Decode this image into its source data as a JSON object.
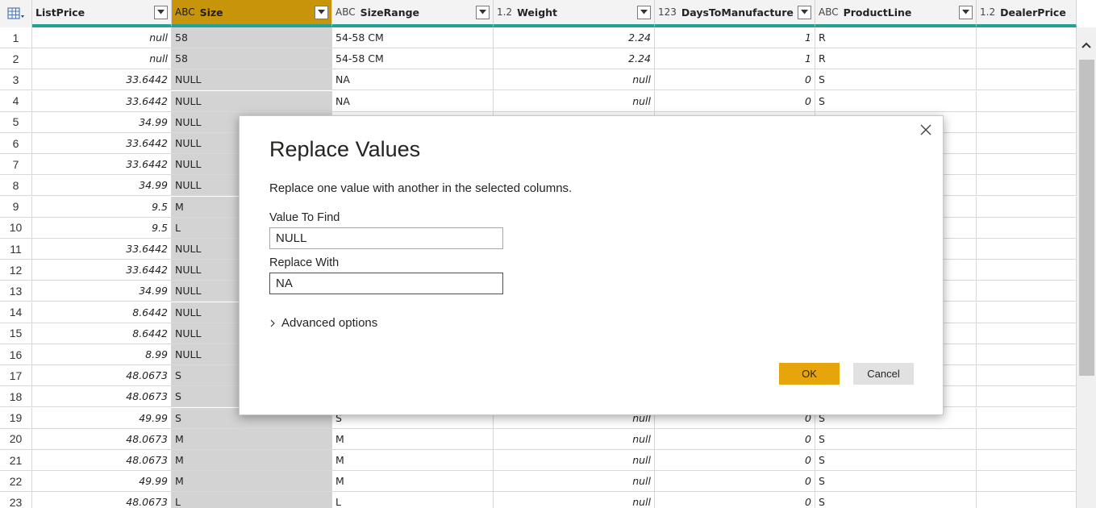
{
  "columns": [
    {
      "name": "ListPrice",
      "type_icon": "",
      "selected": false
    },
    {
      "name": "Size",
      "type_icon": "ABC",
      "selected": true
    },
    {
      "name": "SizeRange",
      "type_icon": "ABC",
      "selected": false
    },
    {
      "name": "Weight",
      "type_icon": "1.2",
      "selected": false
    },
    {
      "name": "DaysToManufacture",
      "type_icon": "123",
      "selected": false
    },
    {
      "name": "ProductLine",
      "type_icon": "ABC",
      "selected": false
    },
    {
      "name": "DealerPrice",
      "type_icon": "1.2",
      "selected": false
    }
  ],
  "rows": [
    {
      "n": "1",
      "ListPrice": "null",
      "Size": "58",
      "SizeRange": "54-58 CM",
      "Weight": "2.24",
      "Days": "1",
      "ProductLine": "R"
    },
    {
      "n": "2",
      "ListPrice": "null",
      "Size": "58",
      "SizeRange": "54-58 CM",
      "Weight": "2.24",
      "Days": "1",
      "ProductLine": "R"
    },
    {
      "n": "3",
      "ListPrice": "33.6442",
      "Size": "NULL",
      "SizeRange": "NA",
      "Weight": "null",
      "Days": "0",
      "ProductLine": "S"
    },
    {
      "n": "4",
      "ListPrice": "33.6442",
      "Size": "NULL",
      "SizeRange": "NA",
      "Weight": "null",
      "Days": "0",
      "ProductLine": "S"
    },
    {
      "n": "5",
      "ListPrice": "34.99",
      "Size": "NULL",
      "SizeRange": "",
      "Weight": "",
      "Days": "",
      "ProductLine": ""
    },
    {
      "n": "6",
      "ListPrice": "33.6442",
      "Size": "NULL",
      "SizeRange": "",
      "Weight": "",
      "Days": "",
      "ProductLine": ""
    },
    {
      "n": "7",
      "ListPrice": "33.6442",
      "Size": "NULL",
      "SizeRange": "",
      "Weight": "",
      "Days": "",
      "ProductLine": ""
    },
    {
      "n": "8",
      "ListPrice": "34.99",
      "Size": "NULL",
      "SizeRange": "",
      "Weight": "",
      "Days": "",
      "ProductLine": ""
    },
    {
      "n": "9",
      "ListPrice": "9.5",
      "Size": "M",
      "SizeRange": "",
      "Weight": "",
      "Days": "",
      "ProductLine": ""
    },
    {
      "n": "10",
      "ListPrice": "9.5",
      "Size": "L",
      "SizeRange": "",
      "Weight": "",
      "Days": "",
      "ProductLine": ""
    },
    {
      "n": "11",
      "ListPrice": "33.6442",
      "Size": "NULL",
      "SizeRange": "",
      "Weight": "",
      "Days": "",
      "ProductLine": ""
    },
    {
      "n": "12",
      "ListPrice": "33.6442",
      "Size": "NULL",
      "SizeRange": "",
      "Weight": "",
      "Days": "",
      "ProductLine": ""
    },
    {
      "n": "13",
      "ListPrice": "34.99",
      "Size": "NULL",
      "SizeRange": "",
      "Weight": "",
      "Days": "",
      "ProductLine": ""
    },
    {
      "n": "14",
      "ListPrice": "8.6442",
      "Size": "NULL",
      "SizeRange": "",
      "Weight": "",
      "Days": "",
      "ProductLine": ""
    },
    {
      "n": "15",
      "ListPrice": "8.6442",
      "Size": "NULL",
      "SizeRange": "",
      "Weight": "",
      "Days": "",
      "ProductLine": ""
    },
    {
      "n": "16",
      "ListPrice": "8.99",
      "Size": "NULL",
      "SizeRange": "",
      "Weight": "",
      "Days": "",
      "ProductLine": ""
    },
    {
      "n": "17",
      "ListPrice": "48.0673",
      "Size": "S",
      "SizeRange": "",
      "Weight": "",
      "Days": "",
      "ProductLine": ""
    },
    {
      "n": "18",
      "ListPrice": "48.0673",
      "Size": "S",
      "SizeRange": "",
      "Weight": "",
      "Days": "",
      "ProductLine": ""
    },
    {
      "n": "19",
      "ListPrice": "49.99",
      "Size": "S",
      "SizeRange": "S",
      "Weight": "null",
      "Days": "0",
      "ProductLine": "S"
    },
    {
      "n": "20",
      "ListPrice": "48.0673",
      "Size": "M",
      "SizeRange": "M",
      "Weight": "null",
      "Days": "0",
      "ProductLine": "S"
    },
    {
      "n": "21",
      "ListPrice": "48.0673",
      "Size": "M",
      "SizeRange": "M",
      "Weight": "null",
      "Days": "0",
      "ProductLine": "S"
    },
    {
      "n": "22",
      "ListPrice": "49.99",
      "Size": "M",
      "SizeRange": "M",
      "Weight": "null",
      "Days": "0",
      "ProductLine": "S"
    },
    {
      "n": "23",
      "ListPrice": "48.0673",
      "Size": "L",
      "SizeRange": "L",
      "Weight": "null",
      "Days": "0",
      "ProductLine": "S"
    }
  ],
  "dialog": {
    "title": "Replace Values",
    "description": "Replace one value with another in the selected columns.",
    "find_label": "Value To Find",
    "find_value": "NULL",
    "replace_label": "Replace With",
    "replace_value": "NA",
    "advanced_label": "Advanced options",
    "ok_label": "OK",
    "cancel_label": "Cancel"
  },
  "colors": {
    "accent_ok": "#e6a50a",
    "selected_header": "#c8950a",
    "header_underline": "#23a194"
  }
}
